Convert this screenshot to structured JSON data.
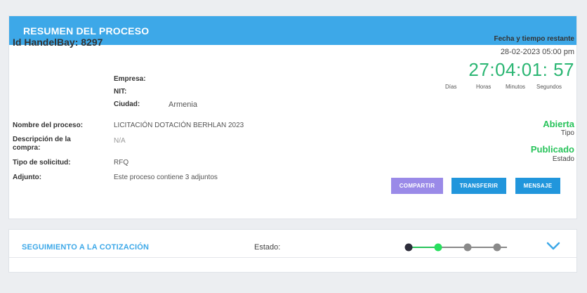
{
  "header": {
    "title": "RESUMEN DEL PROCESO"
  },
  "process": {
    "id_line": "Id HandelBay: 8297",
    "empresa_label": "Empresa:",
    "empresa_value": "",
    "nit_label": "NIT:",
    "nit_value": "",
    "ciudad_label": "Ciudad:",
    "ciudad_value": "Armenia"
  },
  "details": {
    "nombre_label": "Nombre del proceso:",
    "nombre_value": "LICITACIÓN DOTACIÓN BERHLAN 2023",
    "descripcion_label_1": "Descripción de la",
    "descripcion_label_2": "compra:",
    "descripcion_value": "N/A",
    "tipo_solicitud_label": "Tipo de solicitud:",
    "tipo_solicitud_value": "RFQ",
    "adjunto_label": "Adjunto:",
    "adjunto_value": "Este proceso contiene 3 adjuntos"
  },
  "timer": {
    "title": "Fecha y tiempo restante",
    "date": "28-02-2023 05:00 pm",
    "countdown": "27:04:01: 57",
    "labels": [
      "Días",
      "Horas",
      "Minutos",
      "Segundos"
    ]
  },
  "status": {
    "tipo_value": "Abierta",
    "tipo_label": "Tipo",
    "estado_value": "Publicado",
    "estado_label": "Estado",
    "accent_color": "#27c35a"
  },
  "buttons": {
    "compartir": "COMPARTIR",
    "transferir": "TRANSFERIR",
    "mensaje": "MENSAJE"
  },
  "tracking": {
    "title": "SEGUIMIENTO A LA COTIZACIÓN",
    "estado_label": "Estado:",
    "steps_total": 4,
    "current_step": 2
  },
  "colors": {
    "header_blue": "#3da8e8",
    "button_blue": "#2196dc",
    "button_purple": "#9a8ae8",
    "countdown_green": "#2bb673"
  }
}
